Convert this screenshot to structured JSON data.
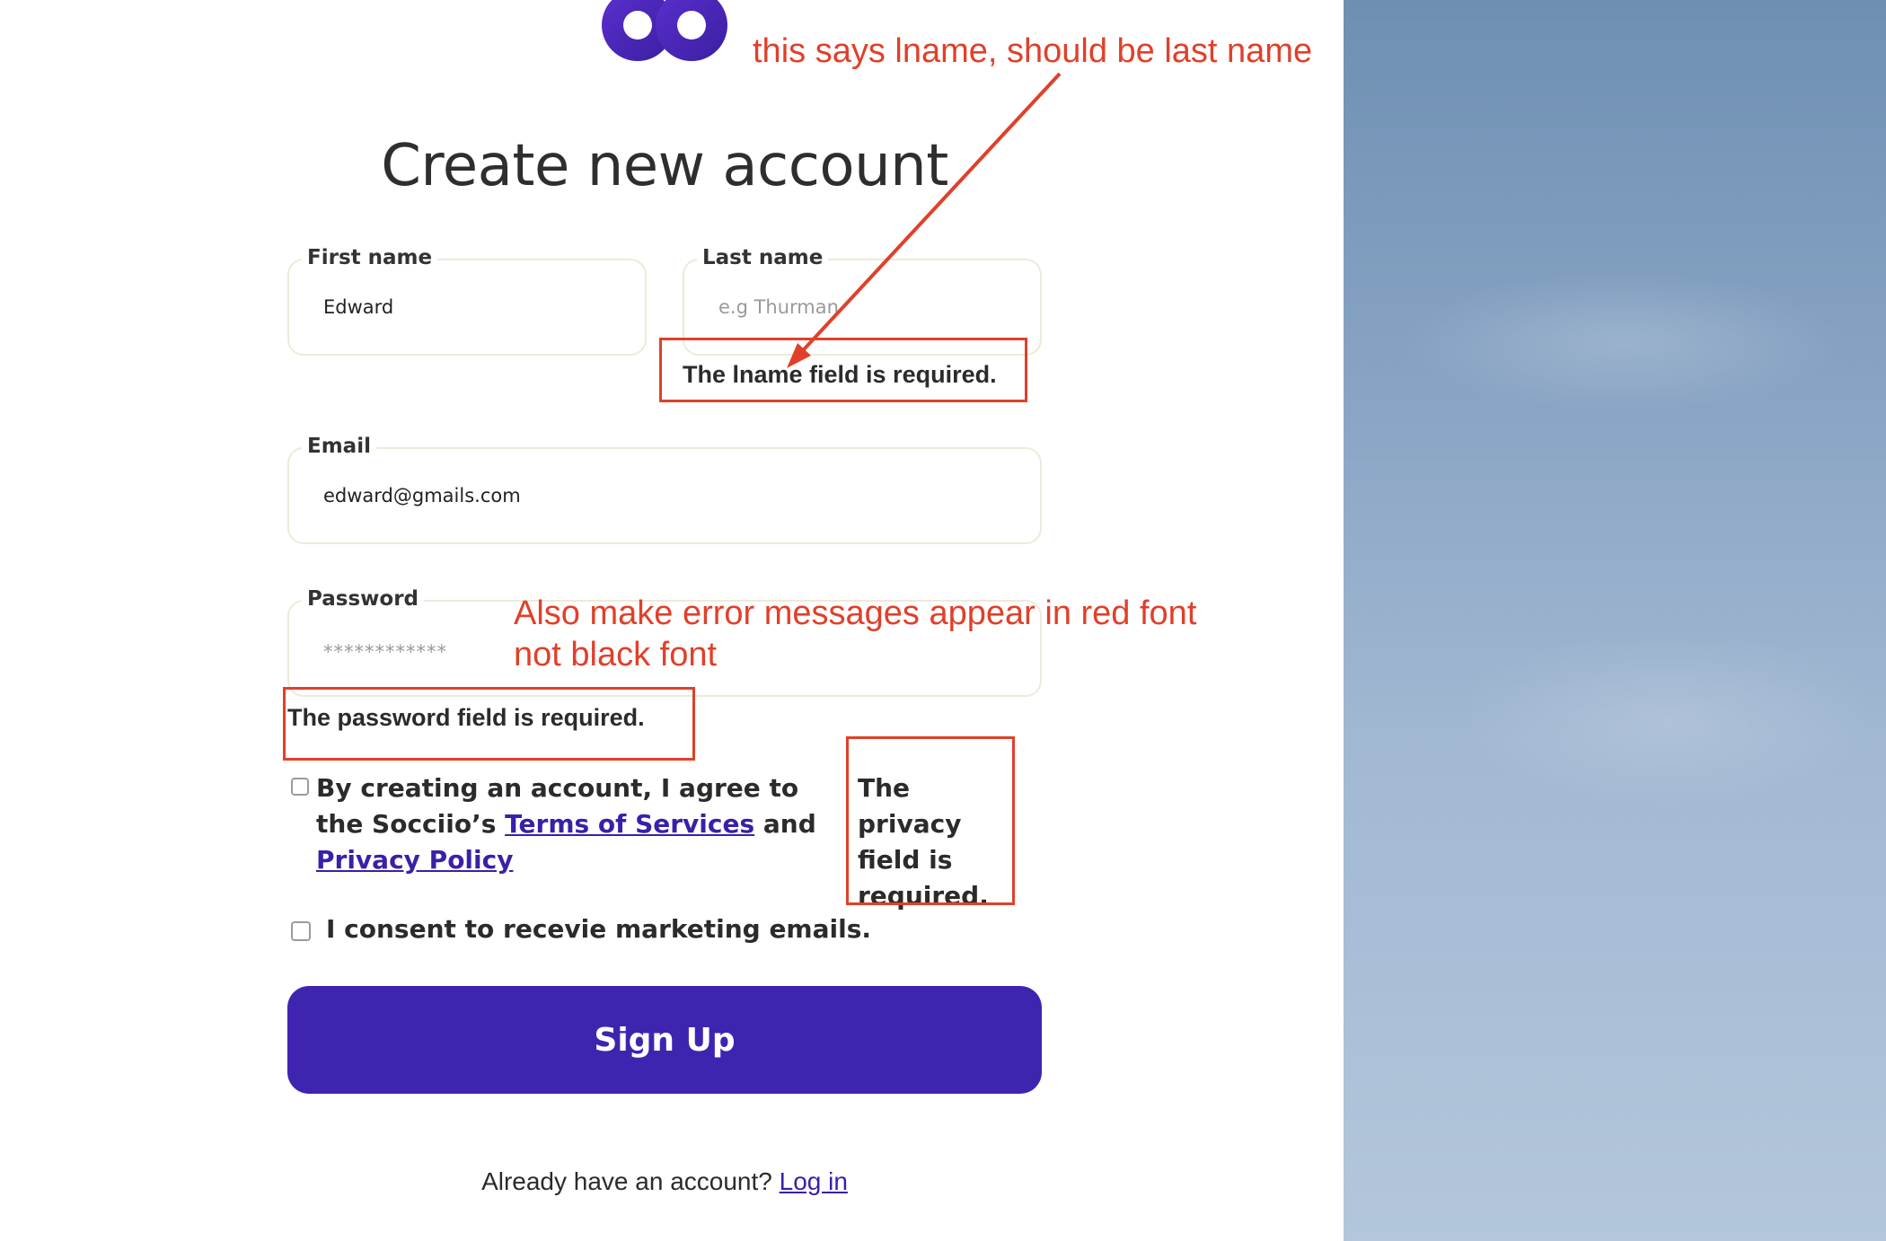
{
  "logo": {
    "name": "socciio-logo"
  },
  "title": "Create new account",
  "form": {
    "first_name": {
      "label": "First name",
      "value": "Edward"
    },
    "last_name": {
      "label": "Last name",
      "placeholder": "e.g Thurman",
      "error": "The lname field is required."
    },
    "email": {
      "label": "Email",
      "value": "edward@gmails.com"
    },
    "password": {
      "label": "Password",
      "masked": "************",
      "error": "The password field is required."
    },
    "terms": {
      "text_before": "By creating an account, I agree to the Socciio’s ",
      "terms_link": "Terms of Services",
      "text_between": " and ",
      "privacy_link": "Privacy Policy",
      "error": "The privacy field is required."
    },
    "consent": {
      "label": "I consent to recevie marketing emails."
    },
    "submit_label": "Sign Up"
  },
  "footer": {
    "prompt": "Already have an account? ",
    "login_link": "Log in"
  },
  "annotations": {
    "note1": "this says lname, should be last name",
    "note2": "Also make error messages appear in red font not black font",
    "color": "#e0402a"
  },
  "colors": {
    "brand": "#3f24b0",
    "link": "#3b1fa8",
    "field_border": "#ecebd9"
  }
}
